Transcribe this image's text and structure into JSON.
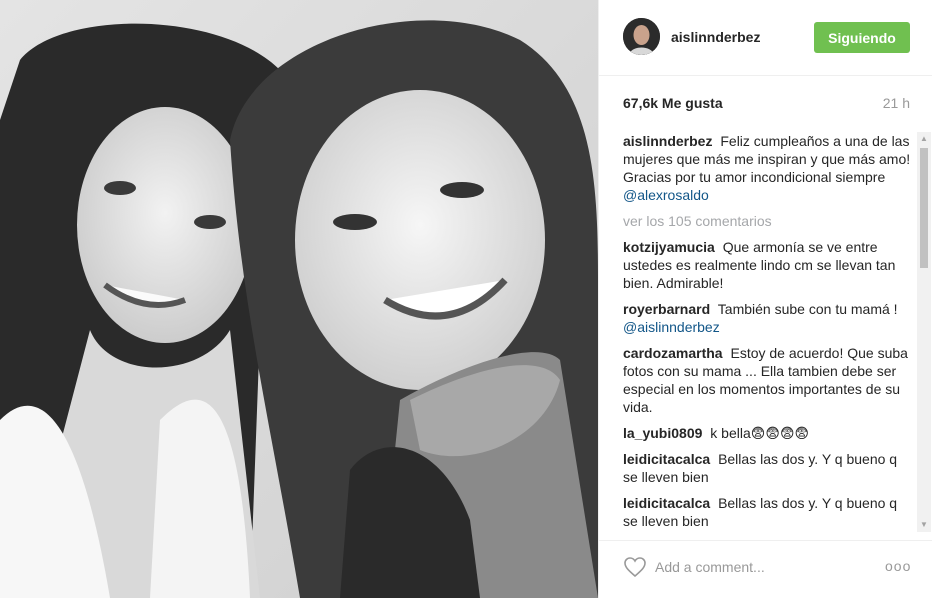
{
  "post": {
    "username": "aislinnderbez",
    "follow_button": "Siguiendo",
    "likes": "67,6k Me gusta",
    "time": "21 h"
  },
  "caption": {
    "user": "aislinnderbez",
    "text": "Feliz cumpleaños a una de las mujeres que más me inspiran y que más amo! Gracias por tu amor incondicional siempre",
    "mention": "@alexrosaldo"
  },
  "view_all": "ver los 105 comentarios",
  "comments": [
    {
      "user": "kotzijyamucia",
      "text": "Que armonía se ve entre ustedes es realmente lindo cm se llevan tan bien. Admirable!",
      "mention": ""
    },
    {
      "user": "royerbarnard",
      "text": "También sube con tu mamá !",
      "mention": "@aislinnderbez"
    },
    {
      "user": "cardozamartha",
      "text": "Estoy de acuerdo! Que suba fotos con su mama ... Ella tambien debe ser especial en los momentos importantes de su vida.",
      "mention": ""
    },
    {
      "user": "la_yubi0809",
      "text": "k bella😨😨😨😨",
      "mention": ""
    },
    {
      "user": "leidicitacalca",
      "text": "Bellas las dos y. Y q bueno q se lleven bien",
      "mention": ""
    },
    {
      "user": "leidicitacalca",
      "text": "Bellas las dos y. Y q bueno q se lleven bien",
      "mention": ""
    }
  ],
  "comment_input": {
    "placeholder": "Add a comment..."
  },
  "more_options": "ooo",
  "icons": {
    "like": "heart-icon",
    "more": "more-options-icon"
  },
  "colors": {
    "follow_button": "#70c050",
    "mention": "#125688",
    "muted": "#999999"
  }
}
